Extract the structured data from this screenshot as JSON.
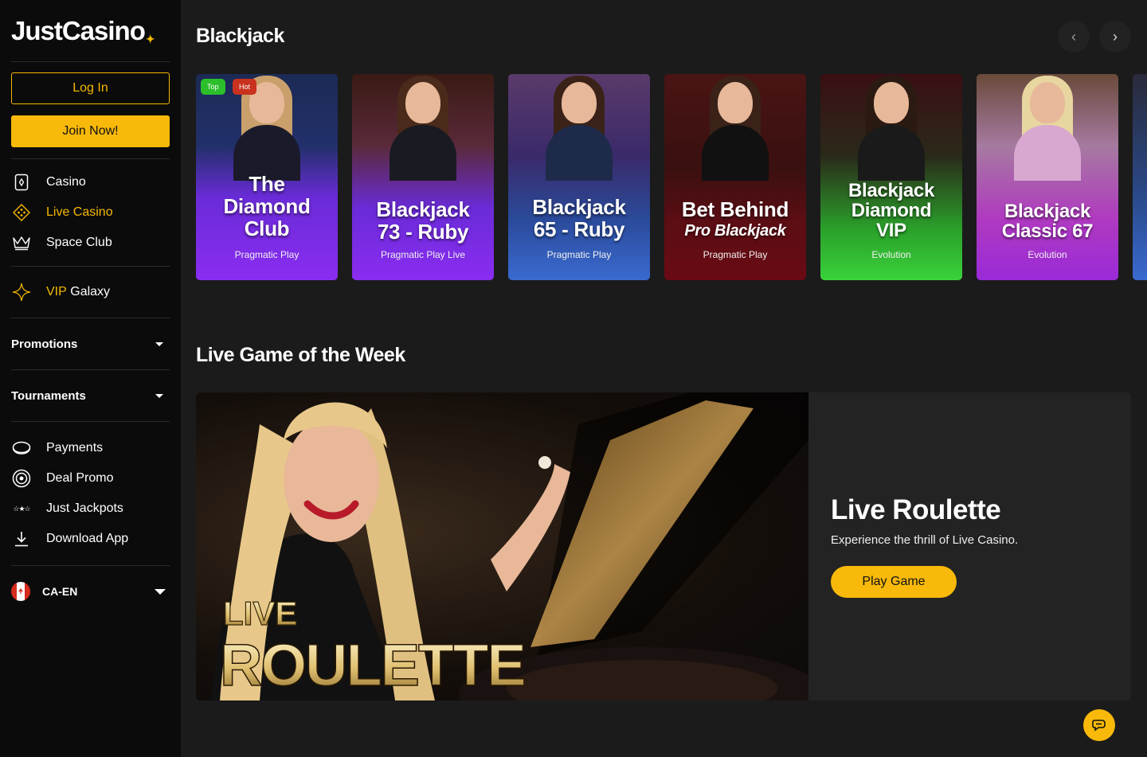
{
  "brand": {
    "logo": "JustCasino",
    "accent": "#f8b90a"
  },
  "auth": {
    "login": "Log In",
    "join": "Join Now!"
  },
  "nav_main": [
    {
      "label": "Casino",
      "icon": "casino-card-icon",
      "active": false
    },
    {
      "label": "Live Casino",
      "icon": "live-casino-icon",
      "active": true
    },
    {
      "label": "Space Club",
      "icon": "crown-icon",
      "active": false
    }
  ],
  "vip": {
    "prefix": "VIP",
    "label": "Galaxy",
    "icon": "sparkle-icon"
  },
  "dropdowns": {
    "promotions": "Promotions",
    "tournaments": "Tournaments"
  },
  "nav_secondary": [
    {
      "label": "Payments",
      "icon": "coin-icon"
    },
    {
      "label": "Deal Promo",
      "icon": "target-icon"
    },
    {
      "label": "Just Jackpots",
      "icon": "stars-icon"
    },
    {
      "label": "Download App",
      "icon": "download-icon"
    }
  ],
  "language": {
    "label": "CA-EN",
    "icon": "canada-flag-icon"
  },
  "blackjack": {
    "title": "Blackjack",
    "cards": [
      {
        "name_lines": [
          "The",
          "Diamond",
          "Club"
        ],
        "provider": "Pragmatic Play",
        "badges": [
          "Top",
          "Hot"
        ]
      },
      {
        "name_lines": [
          "Blackjack",
          "73 - Ruby"
        ],
        "provider": "Pragmatic Play Live",
        "badges": []
      },
      {
        "name_lines": [
          "Blackjack",
          "65 - Ruby"
        ],
        "provider": "Pragmatic Play",
        "badges": []
      },
      {
        "name_lines": [
          "Bet Behind",
          "Pro Blackjack"
        ],
        "provider": "Pragmatic Play",
        "badges": []
      },
      {
        "name_lines": [
          "Blackjack",
          "Diamond",
          "VIP"
        ],
        "provider": "Evolution",
        "badges": []
      },
      {
        "name_lines": [
          "Blackjack",
          "Classic 67"
        ],
        "provider": "Evolution",
        "badges": []
      }
    ]
  },
  "game_of_week": {
    "section_title": "Live Game of the Week",
    "banner_top": "LIVE",
    "banner_main": "ROULETTE",
    "title": "Live Roulette",
    "subtitle": "Experience the thrill of Live Casino.",
    "cta": "Play Game"
  }
}
